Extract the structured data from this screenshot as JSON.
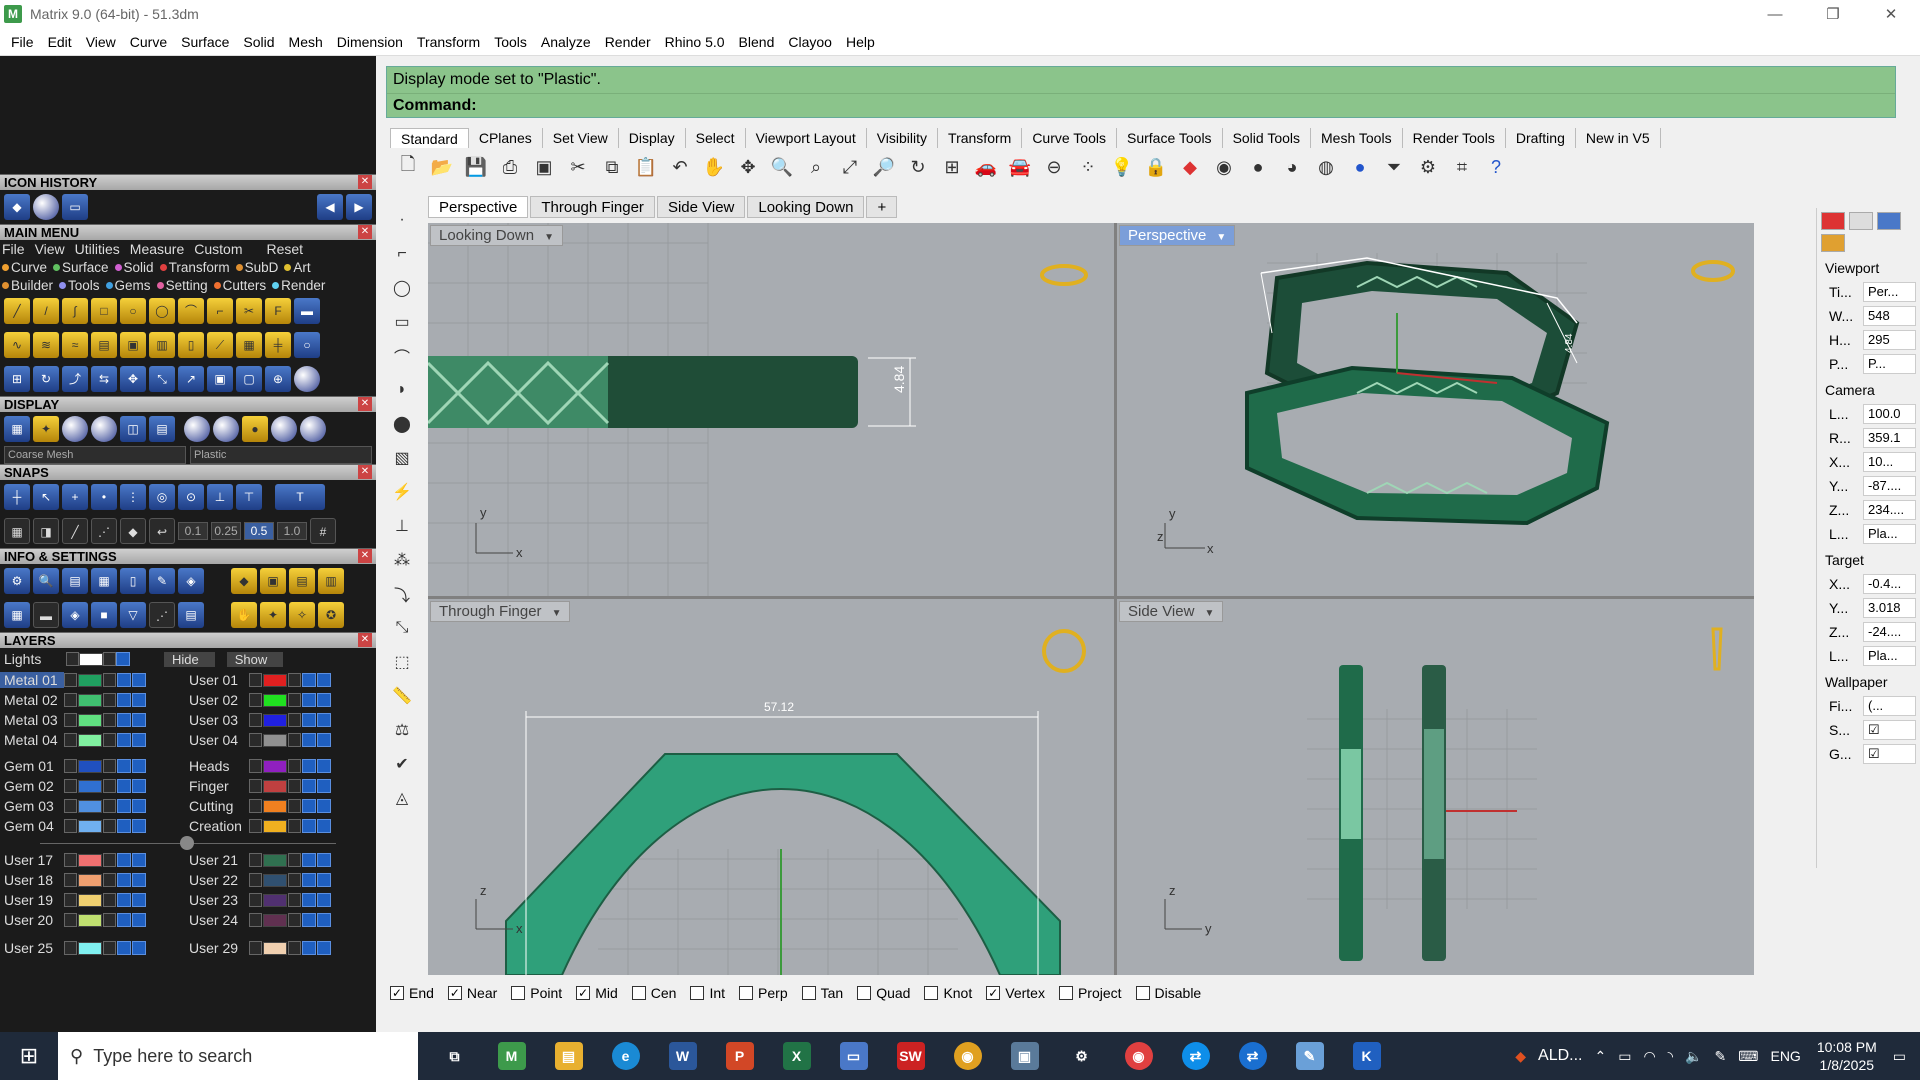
{
  "window": {
    "title": "Matrix 9.0 (64-bit) - 51.3dm",
    "minimize": "—",
    "restore": "❐",
    "close": "✕"
  },
  "menu": [
    "File",
    "Edit",
    "View",
    "Curve",
    "Surface",
    "Solid",
    "Mesh",
    "Dimension",
    "Transform",
    "Tools",
    "Analyze",
    "Render",
    "Rhino 5.0",
    "Blend",
    "Clayoo",
    "Help"
  ],
  "left": {
    "icon_history": "ICON HISTORY",
    "main_menu": "MAIN MENU",
    "main_menu_row1": [
      "File",
      "View",
      "Utilities",
      "Measure",
      "Custom",
      "Reset"
    ],
    "main_menu_row2": [
      {
        "label": "Curve",
        "color": "#f0a030"
      },
      {
        "label": "Surface",
        "color": "#60c060"
      },
      {
        "label": "Solid",
        "color": "#d060d0"
      },
      {
        "label": "Transform",
        "color": "#e04040"
      },
      {
        "label": "SubD",
        "color": "#e09030"
      },
      {
        "label": "Art",
        "color": "#e0c030"
      }
    ],
    "main_menu_row3": [
      {
        "label": "Builder",
        "color": "#e09030"
      },
      {
        "label": "Tools",
        "color": "#9090f0"
      },
      {
        "label": "Gems",
        "color": "#40a0e0"
      },
      {
        "label": "Setting",
        "color": "#e060a0"
      },
      {
        "label": "Cutters",
        "color": "#f07030"
      },
      {
        "label": "Render",
        "color": "#60d0f0"
      }
    ],
    "display": "DISPLAY",
    "display_mesh": "Coarse Mesh",
    "display_mode": "Plastic",
    "snaps": "SNAPS",
    "snap_values": [
      "0.1",
      "0.25",
      "0.5",
      "1.0"
    ],
    "info_settings": "INFO & SETTINGS",
    "layers": "LAYERS",
    "lights": "Lights",
    "hide": "Hide",
    "show": "Show",
    "layers_left": [
      {
        "name": "Metal 01",
        "color": "#20a060"
      },
      {
        "name": "Metal 02",
        "color": "#40c070"
      },
      {
        "name": "Metal 03",
        "color": "#60e080"
      },
      {
        "name": "Metal 04",
        "color": "#80f0a0"
      },
      {
        "name": "Gem 01",
        "color": "#2050c0"
      },
      {
        "name": "Gem 02",
        "color": "#3070d0"
      },
      {
        "name": "Gem 03",
        "color": "#5090e0"
      },
      {
        "name": "Gem 04",
        "color": "#70b0f0"
      },
      {
        "name": "User 17",
        "color": "#f07070"
      },
      {
        "name": "User 18",
        "color": "#f0a070"
      },
      {
        "name": "User 19",
        "color": "#f0d070"
      },
      {
        "name": "User 20",
        "color": "#c0e070"
      },
      {
        "name": "User 25",
        "color": "#80f0f0"
      }
    ],
    "layers_right": [
      {
        "name": "User 01",
        "color": "#e02020"
      },
      {
        "name": "User 02",
        "color": "#20e020"
      },
      {
        "name": "User 03",
        "color": "#2020e0"
      },
      {
        "name": "User 04",
        "color": "#909090"
      },
      {
        "name": "Heads",
        "color": "#9020c0"
      },
      {
        "name": "Finger",
        "color": "#c04040"
      },
      {
        "name": "Cutting",
        "color": "#f08020"
      },
      {
        "name": "Creation",
        "color": "#f0b020"
      },
      {
        "name": "User 21",
        "color": "#307050"
      },
      {
        "name": "User 22",
        "color": "#305070"
      },
      {
        "name": "User 23",
        "color": "#503070"
      },
      {
        "name": "User 24",
        "color": "#603050"
      },
      {
        "name": "User 29",
        "color": "#f0d0b0"
      }
    ]
  },
  "command": {
    "history": "Display mode set to \"Plastic\".",
    "prompt": "Command:"
  },
  "tabs": [
    "Standard",
    "CPlanes",
    "Set View",
    "Display",
    "Select",
    "Viewport Layout",
    "Visibility",
    "Transform",
    "Curve Tools",
    "Surface Tools",
    "Solid Tools",
    "Mesh Tools",
    "Render Tools",
    "Drafting",
    "New in V5"
  ],
  "viewport_tabs": [
    "Perspective",
    "Through Finger",
    "Side View",
    "Looking Down",
    "+"
  ],
  "viewports": {
    "top_left": {
      "label": "Looking Down",
      "dimension": "4.84",
      "axis_x": "x",
      "axis_y": "y"
    },
    "top_right": {
      "label": "Perspective",
      "axis_x": "x",
      "axis_y": "y",
      "axis_z": "z",
      "dimension": "4.84"
    },
    "bottom_left": {
      "label": "Through Finger",
      "dimension": "57.12",
      "axis_x": "x",
      "axis_z": "z"
    },
    "bottom_right": {
      "label": "Side View",
      "axis_y": "y",
      "axis_z": "z"
    }
  },
  "osnaps": [
    {
      "label": "End",
      "checked": true
    },
    {
      "label": "Near",
      "checked": true
    },
    {
      "label": "Point",
      "checked": false
    },
    {
      "label": "Mid",
      "checked": true
    },
    {
      "label": "Cen",
      "checked": false
    },
    {
      "label": "Int",
      "checked": false
    },
    {
      "label": "Perp",
      "checked": false
    },
    {
      "label": "Tan",
      "checked": false
    },
    {
      "label": "Quad",
      "checked": false
    },
    {
      "label": "Knot",
      "checked": false
    },
    {
      "label": "Vertex",
      "checked": true
    },
    {
      "label": "Project",
      "checked": false
    },
    {
      "label": "Disable",
      "checked": false
    }
  ],
  "properties": {
    "viewport": "Viewport",
    "viewport_rows": [
      {
        "k": "Ti...",
        "v": "Per..."
      },
      {
        "k": "W...",
        "v": "548"
      },
      {
        "k": "H...",
        "v": "295"
      },
      {
        "k": "P...",
        "v": "P..."
      }
    ],
    "camera": "Camera",
    "camera_rows": [
      {
        "k": "L...",
        "v": "100.0"
      },
      {
        "k": "R...",
        "v": "359.1"
      },
      {
        "k": "X...",
        "v": "10..."
      },
      {
        "k": "Y...",
        "v": "-87...."
      },
      {
        "k": "Z...",
        "v": "234...."
      },
      {
        "k": "L...",
        "v": "Pla..."
      }
    ],
    "target": "Target",
    "target_rows": [
      {
        "k": "X...",
        "v": "-0.4..."
      },
      {
        "k": "Y...",
        "v": "3.018"
      },
      {
        "k": "Z...",
        "v": "-24...."
      },
      {
        "k": "L...",
        "v": "Pla..."
      }
    ],
    "wallpaper": "Wallpaper",
    "wallpaper_rows": [
      {
        "k": "Fi...",
        "v": "(..."
      },
      {
        "k": "S...",
        "v": "☑"
      },
      {
        "k": "G...",
        "v": "☑"
      }
    ]
  },
  "taskbar": {
    "search_placeholder": "Type here to search",
    "tray_app": "ALD...",
    "lang": "ENG",
    "time": "10:08 PM",
    "date": "1/8/2025"
  }
}
